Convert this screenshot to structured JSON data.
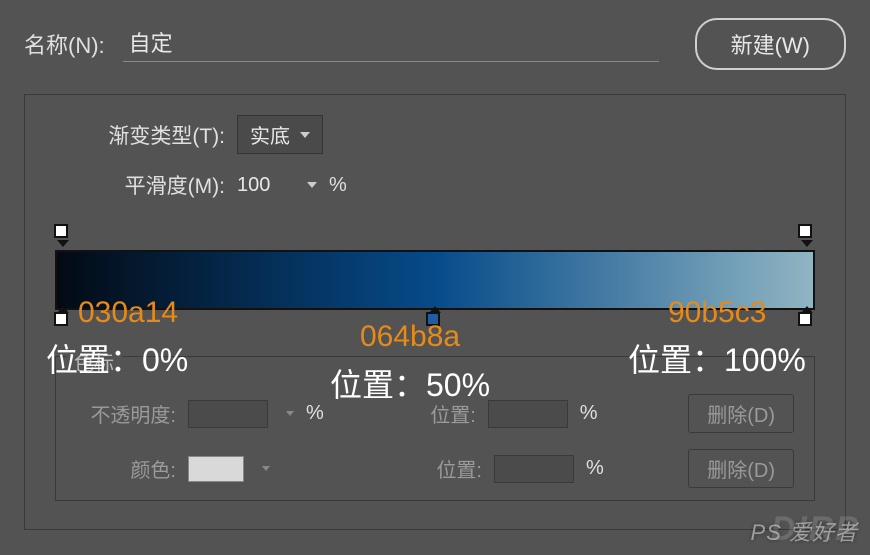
{
  "header": {
    "name_label": "名称(N):",
    "name_value": "自定",
    "new_button": "新建(W)"
  },
  "gradient": {
    "type_label": "渐变类型(T):",
    "type_value": "实底",
    "smooth_label": "平滑度(M):",
    "smooth_value": "100",
    "percent": "%"
  },
  "stops": {
    "section_label": "色标",
    "opacity_label": "不透明度:",
    "opacity_value": "",
    "location_label": "位置:",
    "location_value": "",
    "color_label": "颜色:",
    "delete_label": "删除(D)"
  },
  "chart_data": {
    "type": "gradient",
    "color_stops": [
      {
        "hex": "030a14",
        "location": 0
      },
      {
        "hex": "064b8a",
        "location": 50
      },
      {
        "hex": "90b5c3",
        "location": 100
      }
    ],
    "opacity_stops": [
      {
        "opacity": 100,
        "location": 0
      },
      {
        "opacity": 100,
        "location": 100
      }
    ]
  },
  "annotations": {
    "hex0": "030a14",
    "pos0": "位置：0%",
    "hex1": "064b8a",
    "pos1": "位置：50%",
    "hex2": "90b5c3",
    "pos2": "位置：100%"
  },
  "watermark": {
    "bg": "DIRP",
    "text": "PS 爱好者"
  }
}
